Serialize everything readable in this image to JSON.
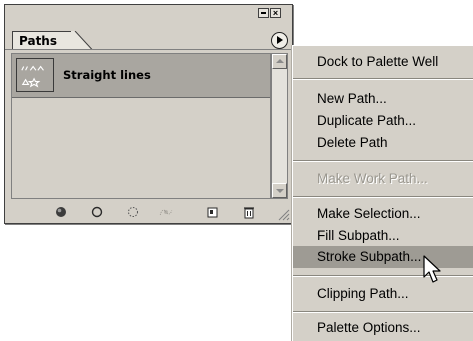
{
  "palette": {
    "tab_label": "Paths",
    "paths": [
      {
        "name": "Straight lines",
        "selected": true
      }
    ],
    "footer_tools": [
      {
        "name": "fill-path-icon"
      },
      {
        "name": "stroke-path-icon"
      },
      {
        "name": "load-path-as-selection-icon"
      },
      {
        "name": "make-work-path-icon"
      },
      {
        "name": "new-path-icon"
      },
      {
        "name": "delete-path-icon"
      }
    ]
  },
  "menu": {
    "items": [
      {
        "label": "Dock to Palette Well",
        "enabled": true
      },
      {
        "label": "New Path...",
        "enabled": true
      },
      {
        "label": "Duplicate Path...",
        "enabled": true
      },
      {
        "label": "Delete Path",
        "enabled": true
      },
      {
        "label": "Make Work Path...",
        "enabled": false
      },
      {
        "label": "Make Selection...",
        "enabled": true
      },
      {
        "label": "Fill Subpath...",
        "enabled": true
      },
      {
        "label": "Stroke Subpath...",
        "enabled": true,
        "highlighted": true
      },
      {
        "label": "Clipping Path...",
        "enabled": true
      },
      {
        "label": "Palette Options...",
        "enabled": true
      }
    ]
  },
  "colors": {
    "panel_bg": "#d4d0c8",
    "selected_row": "#a9a6a0",
    "menu_highlight": "#9e9b94",
    "disabled_text": "#9a978f"
  }
}
